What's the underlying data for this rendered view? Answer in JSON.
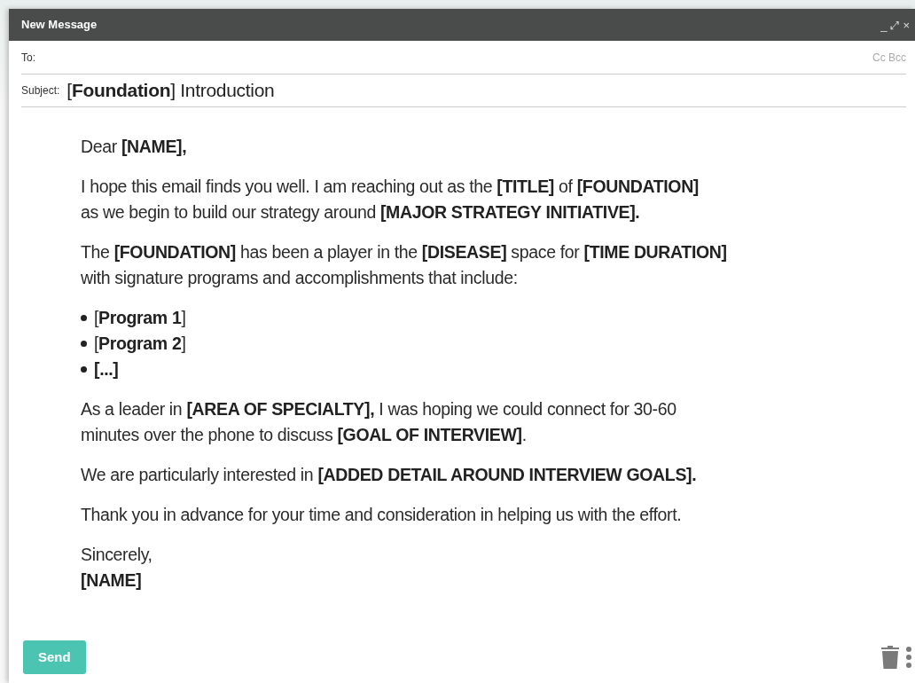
{
  "window": {
    "title": "New Message",
    "controls": [
      "_",
      "⤢",
      "×"
    ]
  },
  "to": {
    "label": "To:",
    "links": "Cc Bcc"
  },
  "subject": {
    "label": "Subject:",
    "value": "[**Foundation**] Introduction"
  },
  "body": [
    {
      "kind": "paragraph",
      "text": "Dear **[NAME],**"
    },
    {
      "kind": "paragraph",
      "text": "I hope this email finds you well. I am reaching out as the **[TITLE]** of **[FOUNDATION]**\nas we begin to build our strategy around **[MAJOR STRATEGY INITIATIVE].**"
    },
    {
      "kind": "paragraph",
      "text": "The **[FOUNDATION]** has been a player in the **[DISEASE]** space for **[TIME DURATION]**\nwith signature programs and accomplishments that include:"
    },
    {
      "kind": "list",
      "items": [
        "[**Program 1**]",
        "[**Program 2**]",
        "**[...]**"
      ]
    },
    {
      "kind": "paragraph",
      "text": "As a leader in **[AREA OF SPECIALTY],** I was hoping we could connect for 30-60\nminutes over the phone to discuss **[GOAL OF INTERVIEW]**."
    },
    {
      "kind": "paragraph",
      "text": "We are particularly interested in **[ADDED DETAIL AROUND INTERVIEW GOALS].**"
    },
    {
      "kind": "paragraph",
      "text": "Thank you in advance for your time and consideration in helping us with the effort."
    },
    {
      "kind": "paragraph",
      "text": "Sincerely,\n**[NAME]**"
    }
  ],
  "footer": {
    "send": "Send"
  }
}
